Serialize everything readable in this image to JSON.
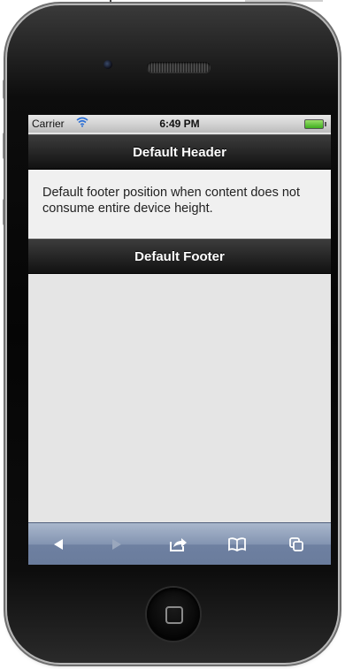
{
  "statusbar": {
    "carrier": "Carrier",
    "time": "6:49 PM",
    "wifi_icon": "wifi-icon",
    "battery_icon": "battery-icon"
  },
  "header": {
    "title": "Default Header"
  },
  "content": {
    "text": "Default footer position when content does not consume entire device height."
  },
  "footer": {
    "title": "Default Footer"
  },
  "toolbar": {
    "items": [
      {
        "icon": "back-arrow-icon",
        "enabled": true
      },
      {
        "icon": "forward-arrow-icon",
        "enabled": false
      },
      {
        "icon": "share-icon",
        "enabled": true
      },
      {
        "icon": "bookmarks-icon",
        "enabled": true
      },
      {
        "icon": "tabs-icon",
        "enabled": true
      }
    ]
  },
  "colors": {
    "bar_dark": "#111111",
    "content_bg": "#f0f0f0",
    "toolbar_blue": "#8394b1"
  }
}
